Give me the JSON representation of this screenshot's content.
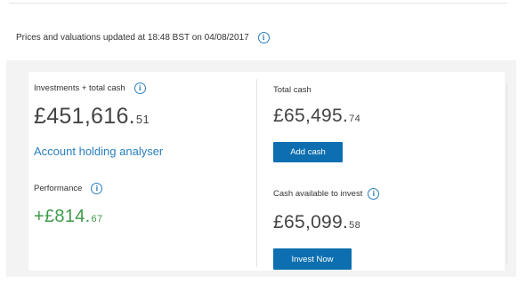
{
  "header": {
    "updated_text": "Prices and valuations updated at 18:48 BST on 04/08/2017"
  },
  "investments": {
    "label": "Investments + total cash",
    "amount_main": "£451,616.",
    "amount_pence": "51",
    "analyser_link": "Account holding analyser"
  },
  "performance": {
    "label": "Performance",
    "amount_main": "+£814.",
    "amount_pence": "67"
  },
  "total_cash": {
    "label": "Total cash",
    "amount_main": "£65,495.",
    "amount_pence": "74",
    "button_label": "Add cash"
  },
  "available": {
    "label": "Cash available to invest",
    "amount_main": "£65,099.",
    "amount_pence": "58",
    "button_label": "Invest Now"
  },
  "colors": {
    "accent": "#2a7fbf",
    "button": "#0d6fb0",
    "positive": "#3d9a49"
  },
  "icons": {
    "info": "info-circle-icon"
  }
}
